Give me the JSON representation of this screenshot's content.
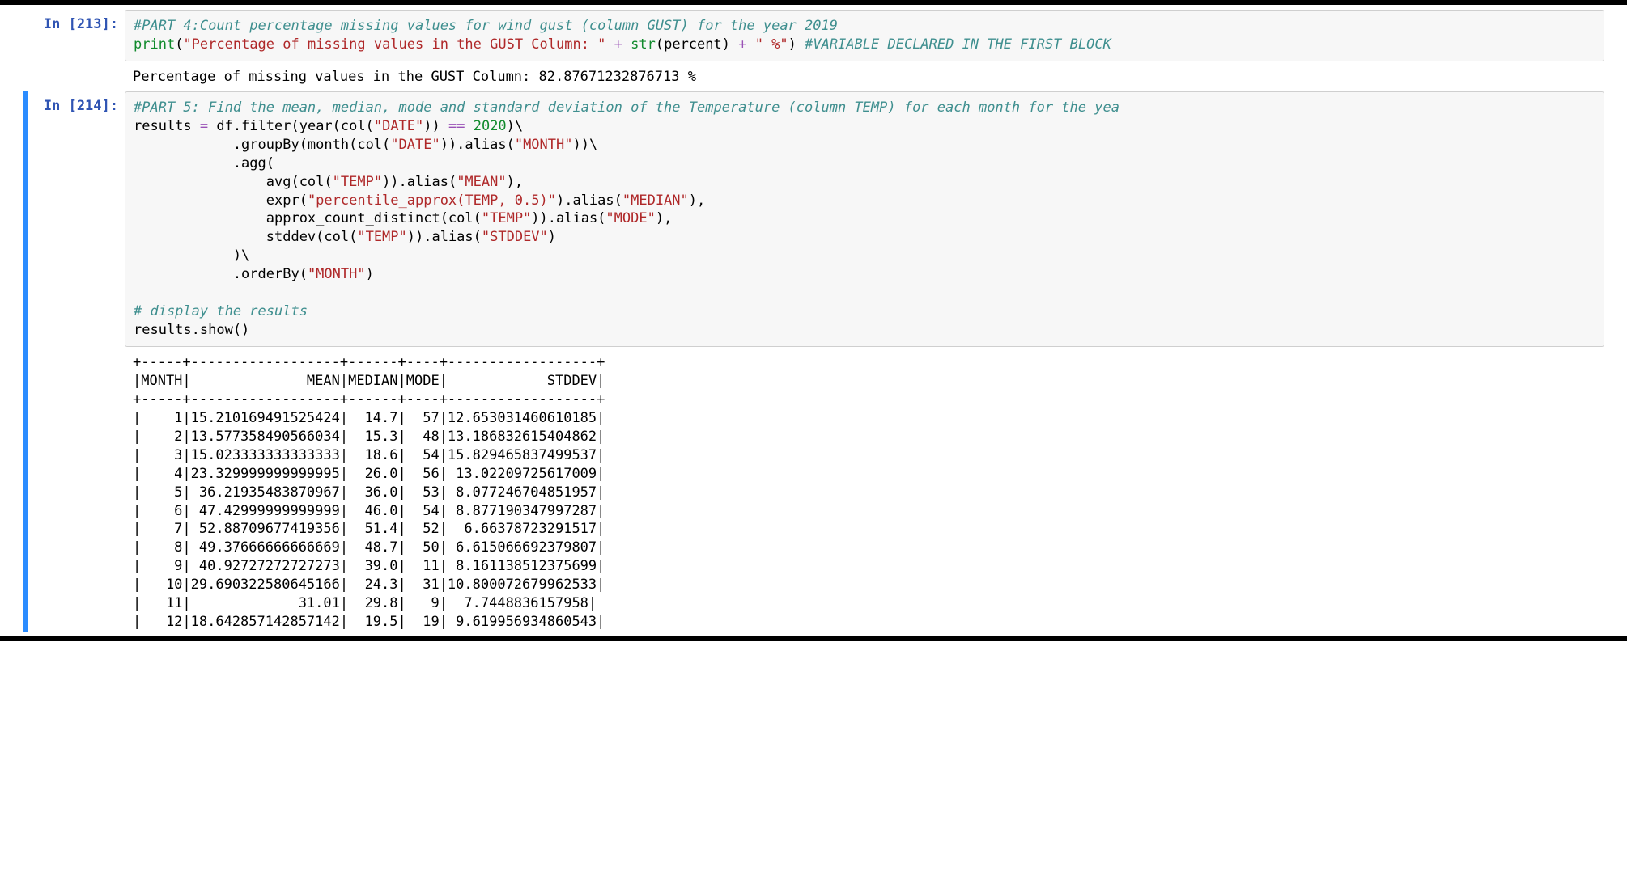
{
  "cell1": {
    "prompt": "In [213]:",
    "comment1": "#PART 4:Count percentage missing values for wind gust (column GUST) for the year 2019",
    "kw_print": "print",
    "str1": "\"Percentage of missing values in the GUST Column: \"",
    "plus1": " + ",
    "kw_str": "str",
    "plain_percent": "(percent)",
    "plus2": " + ",
    "str2": "\" %\"",
    "plain_close": ") ",
    "comment2": "#VARIABLE DECLARED IN THE FIRST BLOCK",
    "output": "Percentage of missing values in the GUST Column: 82.87671232876713 %"
  },
  "cell2": {
    "prompt": "In [214]:",
    "l1_comment": "#PART 5: Find the mean, median, mode and standard deviation of the Temperature (column TEMP) for each month for the yea",
    "l2_a": "results ",
    "l2_eq": "=",
    "l2_b": " df.filter(year(col(",
    "l2_s1": "\"DATE\"",
    "l2_c": ")) ",
    "l2_op": "==",
    "l2_sp": " ",
    "l2_n": "2020",
    "l2_d": ")\\",
    "l3_a": "            .groupBy(month(col(",
    "l3_s1": "\"DATE\"",
    "l3_b": ")).alias(",
    "l3_s2": "\"MONTH\"",
    "l3_c": "))\\",
    "l4": "            .agg(",
    "l5_a": "                avg(col(",
    "l5_s1": "\"TEMP\"",
    "l5_b": ")).alias(",
    "l5_s2": "\"MEAN\"",
    "l5_c": "),",
    "l6_a": "                expr(",
    "l6_s1": "\"percentile_approx(TEMP, 0.5)\"",
    "l6_b": ").alias(",
    "l6_s2": "\"MEDIAN\"",
    "l6_c": "),",
    "l7_a": "                approx_count_distinct(col(",
    "l7_s1": "\"TEMP\"",
    "l7_b": ")).alias(",
    "l7_s2": "\"MODE\"",
    "l7_c": "),",
    "l8_a": "                stddev(col(",
    "l8_s1": "\"TEMP\"",
    "l8_b": ")).alias(",
    "l8_s2": "\"STDDEV\"",
    "l8_c": ")",
    "l9": "            )\\",
    "l10_a": "            .orderBy(",
    "l10_s1": "\"MONTH\"",
    "l10_b": ")",
    "l11": "",
    "l12_comment": "# display the results",
    "l13": "results.show()",
    "output": "+-----+------------------+------+----+------------------+\n|MONTH|              MEAN|MEDIAN|MODE|            STDDEV|\n+-----+------------------+------+----+------------------+\n|    1|15.210169491525424|  14.7|  57|12.653031460610185|\n|    2|13.577358490566034|  15.3|  48|13.186832615404862|\n|    3|15.023333333333333|  18.6|  54|15.829465837499537|\n|    4|23.329999999999995|  26.0|  56| 13.02209725617009|\n|    5| 36.21935483870967|  36.0|  53| 8.077246704851957|\n|    6| 47.42999999999999|  46.0|  54| 8.877190347997287|\n|    7| 52.88709677419356|  51.4|  52|  6.66378723291517|\n|    8| 49.37666666666669|  48.7|  50| 6.615066692379807|\n|    9| 40.92727272727273|  39.0|  11| 8.161138512375699|\n|   10|29.690322580645166|  24.3|  31|10.800072679962533|\n|   11|             31.01|  29.8|   9|  7.7448836157958|\n|   12|18.642857142857142|  19.5|  19| 9.619956934860543|"
  },
  "chart_data": {
    "type": "table",
    "title": "Monthly TEMP statistics for 2020",
    "columns": [
      "MONTH",
      "MEAN",
      "MEDIAN",
      "MODE",
      "STDDEV"
    ],
    "rows": [
      [
        1,
        15.210169491525424,
        14.7,
        57,
        12.653031460610185
      ],
      [
        2,
        13.577358490566034,
        15.3,
        48,
        13.186832615404862
      ],
      [
        3,
        15.023333333333333,
        18.6,
        54,
        15.829465837499537
      ],
      [
        4,
        23.329999999999995,
        26.0,
        56,
        13.02209725617009
      ],
      [
        5,
        36.21935483870967,
        36.0,
        53,
        8.077246704851957
      ],
      [
        6,
        47.42999999999999,
        46.0,
        54,
        8.877190347997287
      ],
      [
        7,
        52.88709677419356,
        51.4,
        52,
        6.66378723291517
      ],
      [
        8,
        49.37666666666669,
        48.7,
        50,
        6.615066692379807
      ],
      [
        9,
        40.92727272727273,
        39.0,
        11,
        8.161138512375699
      ],
      [
        10,
        29.690322580645166,
        24.3,
        31,
        10.800072679962533
      ],
      [
        11,
        31.01,
        29.8,
        9,
        7.7448836157958
      ],
      [
        12,
        18.642857142857142,
        19.5,
        19,
        9.619956934860543
      ]
    ]
  }
}
